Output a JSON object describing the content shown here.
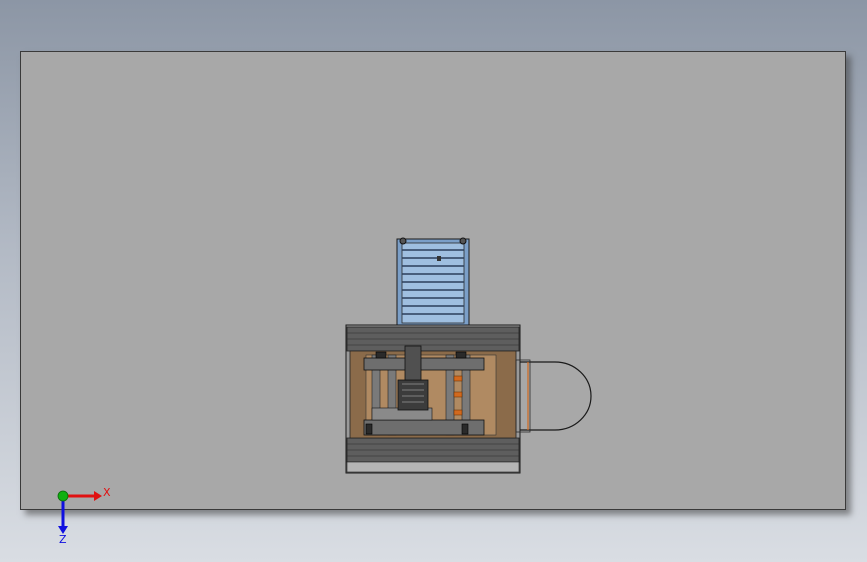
{
  "viewport": {
    "background": "gradient-blue-grey",
    "sheet_color": "#a8a8a8"
  },
  "model": {
    "description_icon": "machine-assembly-top-view",
    "colors": {
      "frame": "#8b6b4a",
      "tray": "#7b9fc8",
      "metal": "#6e6e6e",
      "orange": "#d2691e"
    }
  },
  "triad": {
    "x_label": "X",
    "z_label": "Z",
    "colors": {
      "x": "#e01010",
      "y": "#10b010",
      "z": "#1010e0"
    }
  }
}
